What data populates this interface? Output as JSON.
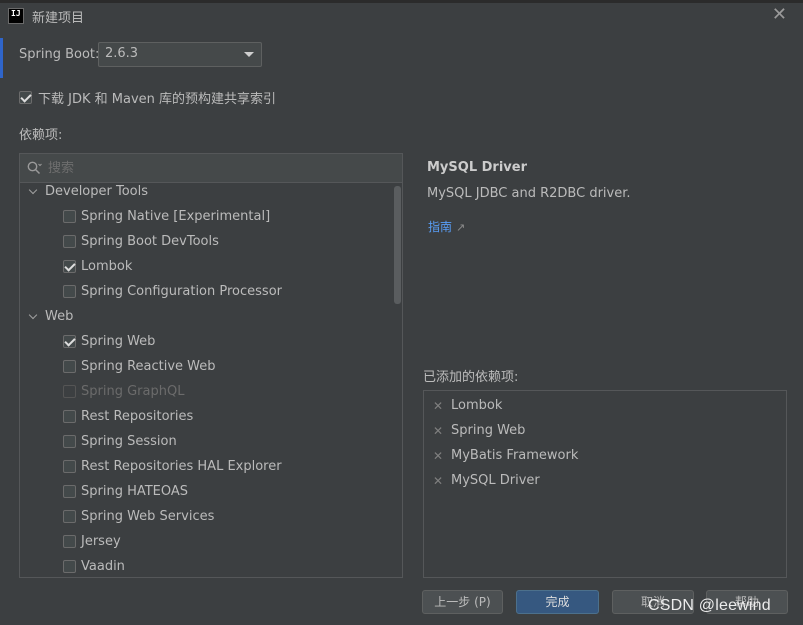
{
  "window": {
    "title": "新建项目",
    "close_glyph": "✕"
  },
  "spring_boot": {
    "label": "Spring Boot:",
    "version": "2.6.3"
  },
  "download_index": {
    "label": "下载 JDK 和 Maven 库的预构建共享索引",
    "checked": true
  },
  "dependencies_label": "依赖项:",
  "search": {
    "placeholder": "搜索",
    "value": ""
  },
  "tree": {
    "groups": [
      {
        "name": "Developer Tools",
        "expanded": true,
        "items": [
          {
            "label": "Spring Native [Experimental]",
            "checked": false,
            "disabled": false
          },
          {
            "label": "Spring Boot DevTools",
            "checked": false,
            "disabled": false
          },
          {
            "label": "Lombok",
            "checked": true,
            "disabled": false
          },
          {
            "label": "Spring Configuration Processor",
            "checked": false,
            "disabled": false
          }
        ]
      },
      {
        "name": "Web",
        "expanded": true,
        "items": [
          {
            "label": "Spring Web",
            "checked": true,
            "disabled": false
          },
          {
            "label": "Spring Reactive Web",
            "checked": false,
            "disabled": false
          },
          {
            "label": "Spring GraphQL",
            "checked": false,
            "disabled": true
          },
          {
            "label": "Rest Repositories",
            "checked": false,
            "disabled": false
          },
          {
            "label": "Spring Session",
            "checked": false,
            "disabled": false
          },
          {
            "label": "Rest Repositories HAL Explorer",
            "checked": false,
            "disabled": false
          },
          {
            "label": "Spring HATEOAS",
            "checked": false,
            "disabled": false
          },
          {
            "label": "Spring Web Services",
            "checked": false,
            "disabled": false
          },
          {
            "label": "Jersey",
            "checked": false,
            "disabled": false
          },
          {
            "label": "Vaadin",
            "checked": false,
            "disabled": false
          }
        ]
      }
    ]
  },
  "detail": {
    "title": "MySQL Driver",
    "description": "MySQL JDBC and R2DBC driver.",
    "guide_link": "指南",
    "guide_arrow": "↗"
  },
  "added": {
    "label": "已添加的依赖项:",
    "items": [
      "Lombok",
      "Spring Web",
      "MyBatis Framework",
      "MySQL Driver"
    ],
    "remove_glyph": "✕"
  },
  "buttons": {
    "prev": "上一步 (P)",
    "finish": "完成",
    "cancel": "取消",
    "help": "帮助"
  },
  "watermark": "CSDN @leewind",
  "colors": {
    "background": "#3c3f41",
    "accent_button": "#365880",
    "link": "#589df6",
    "text": "#bbbbbb"
  }
}
